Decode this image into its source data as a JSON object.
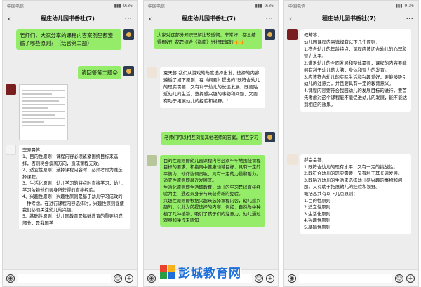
{
  "status": {
    "carrier": "中国电信",
    "time": "9:36"
  },
  "chat_title": "程庄幼儿园书香社(7)",
  "icons": {
    "back": "back-icon",
    "more": "more-icon",
    "voice": "voice-icon",
    "emoji": "emoji-icon",
    "plus": "plus-icon"
  },
  "screens": [
    {
      "messages": [
        {
          "text": "老师们，大家分享的课程内容案例里都遵循了哪些原则？（结合第二题）"
        },
        {
          "text": "请回答第二题😜"
        },
        {
          "sender": "李晓晨",
          "text": "李晓晨答：\n1、目的性原则：课程内容必须紧紧围绕目标来选择，否则将会偏离方向，造成课程无效。\n2、适宜性原则：选择课程内容时，必须考虑为谁选择课程。\n3、生活化原则：幼儿学习的特点时直接学习，幼儿学习依赖他们亲身所获得的直接经验。\n4、兴趣性原则：兴趣性原则是基于幼儿学习成效的一种考虑。在进行课程内容选择时，兴趣性原则促使我们必须关注幼儿的兴趣。\n5、基础性原则：幼儿园教育是基础教育的重要组成部分，是我国学"
        }
      ]
    },
    {
      "messages": [
        {
          "text": "大家对这部分知识理解比较透彻，非常好，都总结得很好！都是结合《指南》进行理解的👍👍"
        },
        {
          "sender": "夏天答",
          "text": "夏天答:我们从游戏的角度选择出发，选择的内容遵循了如下原则，在《纲要》提出的\"既符合幼儿的现实需要，又有利于幼儿的长远发展，既要贴近幼儿的生活，选择感兴趣的事物和问题，又要有助于拓展幼儿的经验和视野。\""
        },
        {
          "text": "老师们可以相互浏览其他老师的答案，相互学习"
        },
        {
          "text": "目的性原则即幼儿园课程内容必须牢牢地围绕课程目标的要求，和指南中健康领域目标：具有一定的平衡力，动作协调灵敏，具有一定的力量和耐力。\n适宜性原则即最近发展区。\n生活化原则即生活即教育，幼儿的学习是以直接经验为主，通过亲身参与来获得新的经验。\n兴趣性原则即根据兴趣来选择课程内容，幼儿感兴趣的，以此为前提选择的内容，例如：自然角中种植了几种植物，吸引了孩子们的注意力，幼儿通过观察和操作来感知"
        }
      ]
    },
    {
      "messages": [
        {
          "sender": "叔芳答",
          "text": "叔芳答：\n幼儿园课程内容选择有以下几个原则：\n1.符合幼儿的年龄特点，课程应该切合幼儿的心理和智力水平。\n2.满足幼儿的全面发展和整体需要，课程的内容要能够有利于幼儿的大脑，身体和智力的发育。\n3.应该符合幼儿的实际生活和兴趣爱好，要能够吸引幼儿的注意力，并且要具有一定的教育意义。\n4.课程内容要符合我园幼儿的发展目标的进行，要首先考虑对这个课程能不能促进幼儿的发展，能不能达到相应的效果。"
        },
        {
          "sender": "郝会答",
          "text": "郝会会答：\n1.既符合幼儿的现有水平，又有一定的挑战性。\n2.既符合幼儿的现实需要，又有利于其长远发展。\n3.既贴近幼儿的生活来选择幼儿感兴趣的事物和问题，又有助于拓展幼儿的经验和视野。\n概括总共有以下几点原则：\n1.目的性原则\n2.适宜性原则\n3.生活化原则\n4.兴趣性原则\n5.基础性原则"
        }
      ]
    }
  ],
  "watermark": {
    "text": "彭城教育网"
  }
}
